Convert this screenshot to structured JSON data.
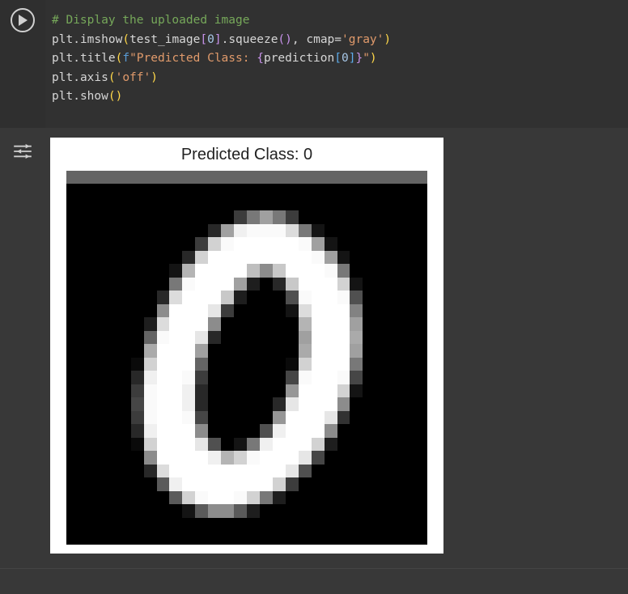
{
  "code": {
    "line1_comment": "# Display the uploaded image",
    "line2": {
      "obj": "plt",
      "dot": ".",
      "fn": "imshow",
      "lp": "(",
      "arg1": "test_image",
      "lb": "[",
      "idx": "0",
      "rb": "]",
      "dot2": ".",
      "fn2": "squeeze",
      "lp2": "(",
      "rp2": ")",
      "comma": ", ",
      "kw": "cmap",
      "eq": "=",
      "str": "'gray'",
      "rp": ")"
    },
    "line3": {
      "obj": "plt",
      "dot": ".",
      "fn": "title",
      "lp": "(",
      "fpre": "f",
      "q1": "\"",
      "txt1": "Predicted Class: ",
      "lbrace": "{",
      "expr": "prediction",
      "lb": "[",
      "idx": "0",
      "rb": "]",
      "rbrace": "}",
      "q2": "\"",
      "rp": ")"
    },
    "line4": {
      "obj": "plt",
      "dot": ".",
      "fn": "axis",
      "lp": "(",
      "str": "'off'",
      "rp": ")"
    },
    "line5": {
      "obj": "plt",
      "dot": ".",
      "fn": "show",
      "lp": "(",
      "rp": ")"
    }
  },
  "chart_data": {
    "type": "heatmap",
    "title": "Predicted Class: 0",
    "colormap": "gray",
    "axis": "off",
    "description": "28x28 MNIST grayscale image depicting handwritten digit zero",
    "rows": 28,
    "cols": 28,
    "pixels": [
      [
        100,
        100,
        100,
        100,
        100,
        100,
        100,
        100,
        100,
        100,
        100,
        100,
        100,
        100,
        100,
        100,
        100,
        100,
        100,
        100,
        100,
        100,
        100,
        100,
        100,
        100,
        100,
        100
      ],
      [
        0,
        0,
        0,
        0,
        0,
        0,
        0,
        0,
        0,
        0,
        0,
        0,
        0,
        0,
        0,
        0,
        0,
        0,
        0,
        0,
        0,
        0,
        0,
        0,
        0,
        0,
        0,
        0
      ],
      [
        0,
        0,
        0,
        0,
        0,
        0,
        0,
        0,
        0,
        0,
        0,
        0,
        0,
        0,
        0,
        0,
        0,
        0,
        0,
        0,
        0,
        0,
        0,
        0,
        0,
        0,
        0,
        0
      ],
      [
        0,
        0,
        0,
        0,
        0,
        0,
        0,
        0,
        0,
        0,
        0,
        0,
        0,
        60,
        120,
        160,
        120,
        60,
        0,
        0,
        0,
        0,
        0,
        0,
        0,
        0,
        0,
        0
      ],
      [
        0,
        0,
        0,
        0,
        0,
        0,
        0,
        0,
        0,
        0,
        0,
        40,
        160,
        240,
        250,
        250,
        250,
        220,
        120,
        20,
        0,
        0,
        0,
        0,
        0,
        0,
        0,
        0
      ],
      [
        0,
        0,
        0,
        0,
        0,
        0,
        0,
        0,
        0,
        0,
        60,
        210,
        250,
        255,
        255,
        255,
        255,
        255,
        250,
        160,
        20,
        0,
        0,
        0,
        0,
        0,
        0,
        0
      ],
      [
        0,
        0,
        0,
        0,
        0,
        0,
        0,
        0,
        0,
        40,
        210,
        255,
        255,
        255,
        255,
        255,
        255,
        255,
        255,
        250,
        160,
        20,
        0,
        0,
        0,
        0,
        0,
        0
      ],
      [
        0,
        0,
        0,
        0,
        0,
        0,
        0,
        0,
        20,
        180,
        255,
        255,
        255,
        255,
        190,
        140,
        200,
        255,
        255,
        255,
        250,
        120,
        0,
        0,
        0,
        0,
        0,
        0
      ],
      [
        0,
        0,
        0,
        0,
        0,
        0,
        0,
        0,
        120,
        250,
        255,
        255,
        255,
        160,
        30,
        0,
        40,
        200,
        255,
        255,
        255,
        210,
        20,
        0,
        0,
        0,
        0,
        0
      ],
      [
        0,
        0,
        0,
        0,
        0,
        0,
        0,
        40,
        220,
        255,
        255,
        255,
        200,
        30,
        0,
        0,
        0,
        80,
        250,
        255,
        255,
        250,
        80,
        0,
        0,
        0,
        0,
        0
      ],
      [
        0,
        0,
        0,
        0,
        0,
        0,
        0,
        140,
        255,
        255,
        255,
        230,
        60,
        0,
        0,
        0,
        0,
        20,
        220,
        255,
        255,
        255,
        130,
        0,
        0,
        0,
        0,
        0
      ],
      [
        0,
        0,
        0,
        0,
        0,
        0,
        30,
        220,
        255,
        255,
        255,
        140,
        0,
        0,
        0,
        0,
        0,
        0,
        180,
        255,
        255,
        255,
        160,
        0,
        0,
        0,
        0,
        0
      ],
      [
        0,
        0,
        0,
        0,
        0,
        0,
        100,
        250,
        255,
        255,
        230,
        40,
        0,
        0,
        0,
        0,
        0,
        0,
        160,
        255,
        255,
        255,
        170,
        0,
        0,
        0,
        0,
        0
      ],
      [
        0,
        0,
        0,
        0,
        0,
        0,
        170,
        255,
        255,
        255,
        160,
        0,
        0,
        0,
        0,
        0,
        0,
        0,
        170,
        255,
        255,
        255,
        160,
        0,
        0,
        0,
        0,
        0
      ],
      [
        0,
        0,
        0,
        0,
        0,
        10,
        210,
        255,
        255,
        255,
        100,
        0,
        0,
        0,
        0,
        0,
        0,
        10,
        210,
        255,
        255,
        255,
        120,
        0,
        0,
        0,
        0,
        0
      ],
      [
        0,
        0,
        0,
        0,
        0,
        40,
        240,
        255,
        255,
        250,
        60,
        0,
        0,
        0,
        0,
        0,
        0,
        70,
        250,
        255,
        255,
        250,
        70,
        0,
        0,
        0,
        0,
        0
      ],
      [
        0,
        0,
        0,
        0,
        0,
        60,
        250,
        255,
        255,
        240,
        40,
        0,
        0,
        0,
        0,
        0,
        0,
        150,
        255,
        255,
        255,
        210,
        20,
        0,
        0,
        0,
        0,
        0
      ],
      [
        0,
        0,
        0,
        0,
        0,
        70,
        250,
        255,
        255,
        240,
        40,
        0,
        0,
        0,
        0,
        0,
        40,
        230,
        255,
        255,
        255,
        140,
        0,
        0,
        0,
        0,
        0,
        0
      ],
      [
        0,
        0,
        0,
        0,
        0,
        60,
        250,
        255,
        255,
        250,
        70,
        0,
        0,
        0,
        0,
        0,
        150,
        255,
        255,
        255,
        230,
        50,
        0,
        0,
        0,
        0,
        0,
        0
      ],
      [
        0,
        0,
        0,
        0,
        0,
        40,
        240,
        255,
        255,
        255,
        140,
        0,
        0,
        0,
        0,
        80,
        240,
        255,
        255,
        255,
        140,
        0,
        0,
        0,
        0,
        0,
        0,
        0
      ],
      [
        0,
        0,
        0,
        0,
        0,
        10,
        210,
        255,
        255,
        255,
        230,
        80,
        0,
        20,
        120,
        240,
        255,
        255,
        255,
        210,
        30,
        0,
        0,
        0,
        0,
        0,
        0,
        0
      ],
      [
        0,
        0,
        0,
        0,
        0,
        0,
        140,
        255,
        255,
        255,
        255,
        240,
        180,
        210,
        250,
        255,
        255,
        255,
        230,
        70,
        0,
        0,
        0,
        0,
        0,
        0,
        0,
        0
      ],
      [
        0,
        0,
        0,
        0,
        0,
        0,
        40,
        220,
        255,
        255,
        255,
        255,
        255,
        255,
        255,
        255,
        255,
        230,
        80,
        0,
        0,
        0,
        0,
        0,
        0,
        0,
        0,
        0
      ],
      [
        0,
        0,
        0,
        0,
        0,
        0,
        0,
        90,
        240,
        255,
        255,
        255,
        255,
        255,
        255,
        255,
        210,
        60,
        0,
        0,
        0,
        0,
        0,
        0,
        0,
        0,
        0,
        0
      ],
      [
        0,
        0,
        0,
        0,
        0,
        0,
        0,
        0,
        90,
        210,
        250,
        255,
        255,
        250,
        210,
        120,
        30,
        0,
        0,
        0,
        0,
        0,
        0,
        0,
        0,
        0,
        0,
        0
      ],
      [
        0,
        0,
        0,
        0,
        0,
        0,
        0,
        0,
        0,
        20,
        90,
        140,
        140,
        90,
        30,
        0,
        0,
        0,
        0,
        0,
        0,
        0,
        0,
        0,
        0,
        0,
        0,
        0
      ],
      [
        0,
        0,
        0,
        0,
        0,
        0,
        0,
        0,
        0,
        0,
        0,
        0,
        0,
        0,
        0,
        0,
        0,
        0,
        0,
        0,
        0,
        0,
        0,
        0,
        0,
        0,
        0,
        0
      ],
      [
        0,
        0,
        0,
        0,
        0,
        0,
        0,
        0,
        0,
        0,
        0,
        0,
        0,
        0,
        0,
        0,
        0,
        0,
        0,
        0,
        0,
        0,
        0,
        0,
        0,
        0,
        0,
        0
      ]
    ]
  }
}
